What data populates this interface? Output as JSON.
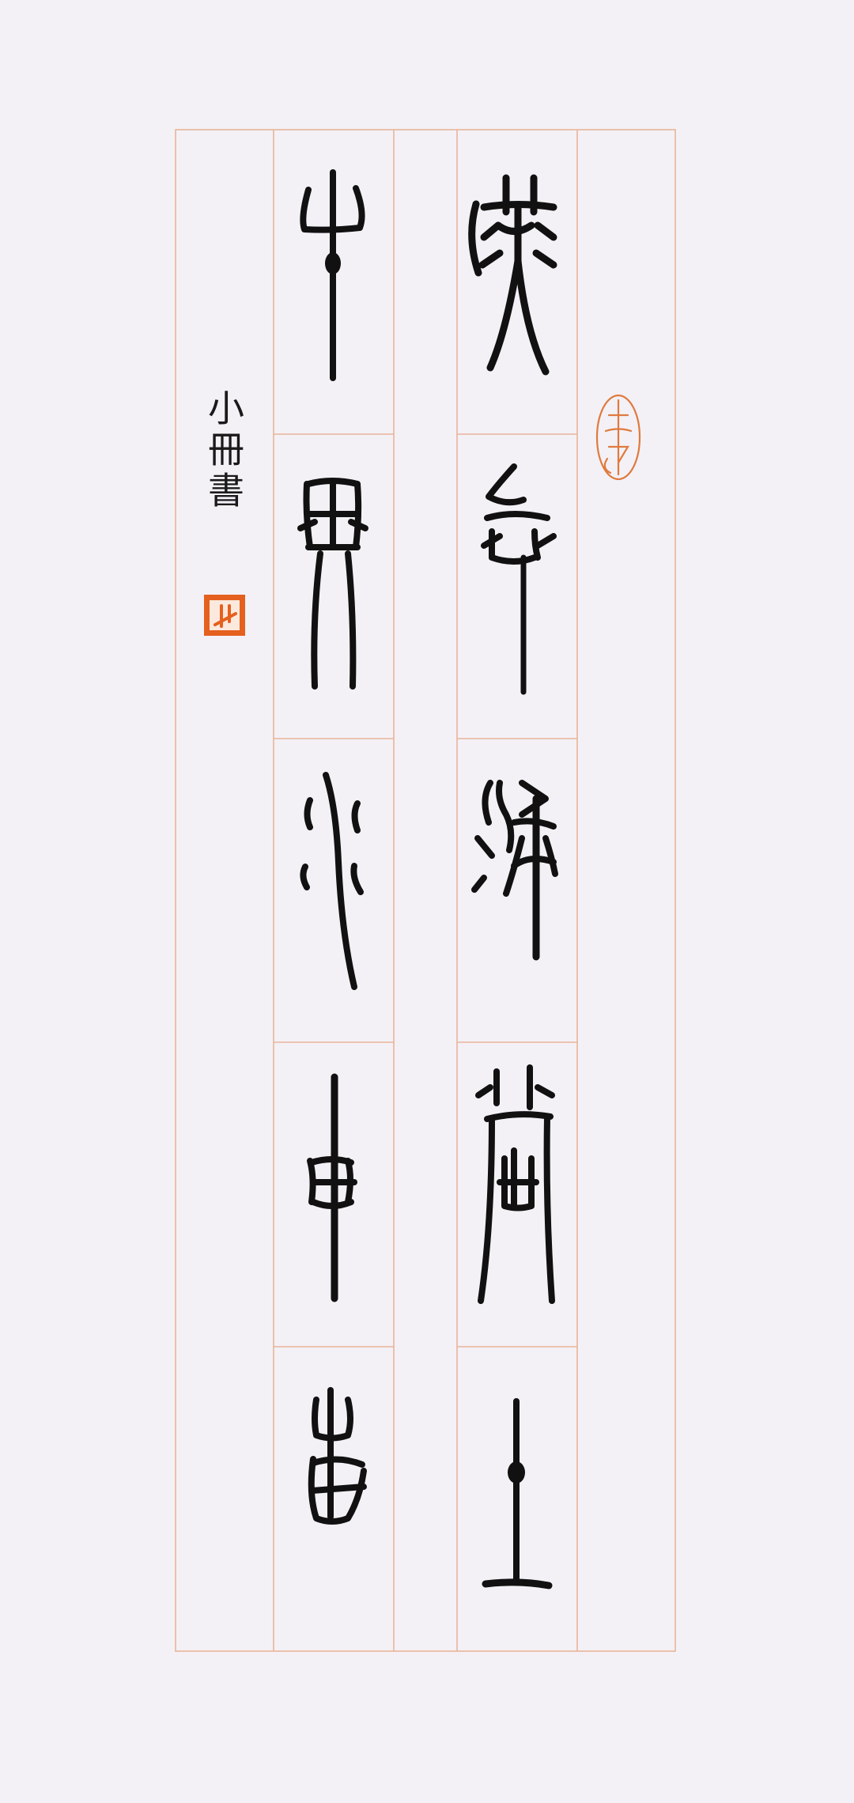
{
  "artwork": {
    "style": "bronze-script (jinwen) calligraphy on ruled grid paper",
    "columns_right_to_left": [
      {
        "column": 1,
        "characters": [
          "燕",
          "啼",
          "深",
          "處",
          "上"
        ]
      },
      {
        "column": 2,
        "characters": [
          "牛",
          "界",
          "水",
          "東",
          "西"
        ]
      }
    ],
    "signature": "小冊書",
    "seals": [
      "leisure-seal",
      "name-seal"
    ],
    "colors": {
      "paper": "#f3f1f6",
      "grid_lines": "#e9b49a",
      "ink": "#111111",
      "seal_red": "#e5601e"
    }
  }
}
